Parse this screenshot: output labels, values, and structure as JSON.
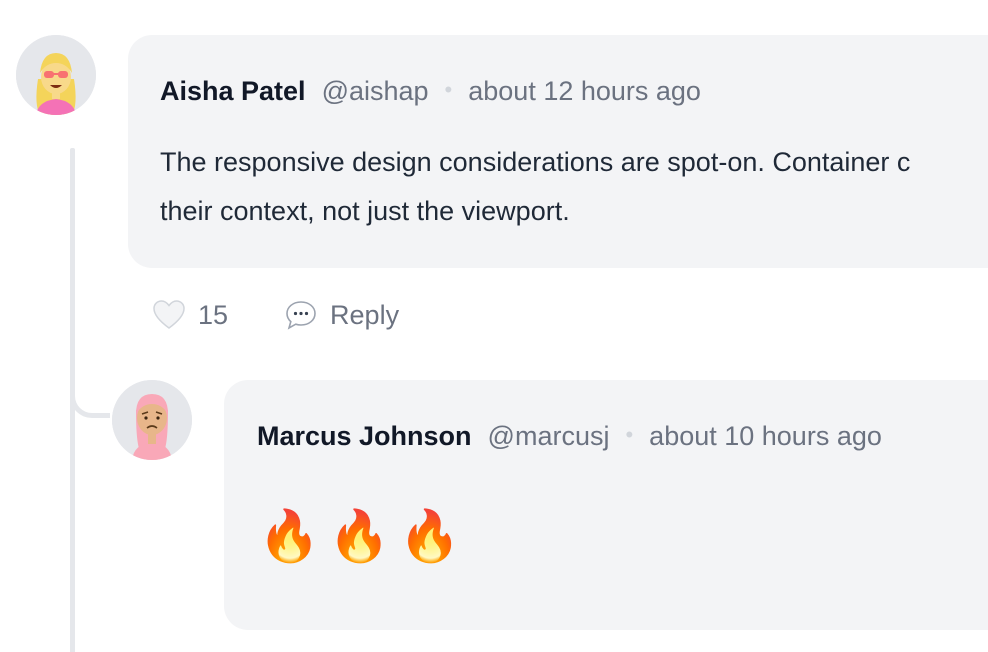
{
  "comment": {
    "author": "Aisha Patel",
    "handle": "@aishap",
    "separator": "•",
    "time": "about 12 hours ago",
    "body_line1": "The responsive design considerations are spot-on. Container c",
    "body_line2": "their context, not just the viewport.",
    "likes": "15",
    "reply_label": "Reply"
  },
  "reply": {
    "author": "Marcus Johnson",
    "handle": "@marcusj",
    "separator": "•",
    "time": "about 10 hours ago",
    "emojis": [
      "🔥",
      "🔥",
      "🔥"
    ]
  },
  "icons": {
    "heart": "heart-icon",
    "reply": "speech-bubble-icon"
  },
  "colors": {
    "bubble": "#f3f4f6",
    "author": "#111827",
    "muted": "#6b7280",
    "thread_line": "#e5e7eb"
  }
}
